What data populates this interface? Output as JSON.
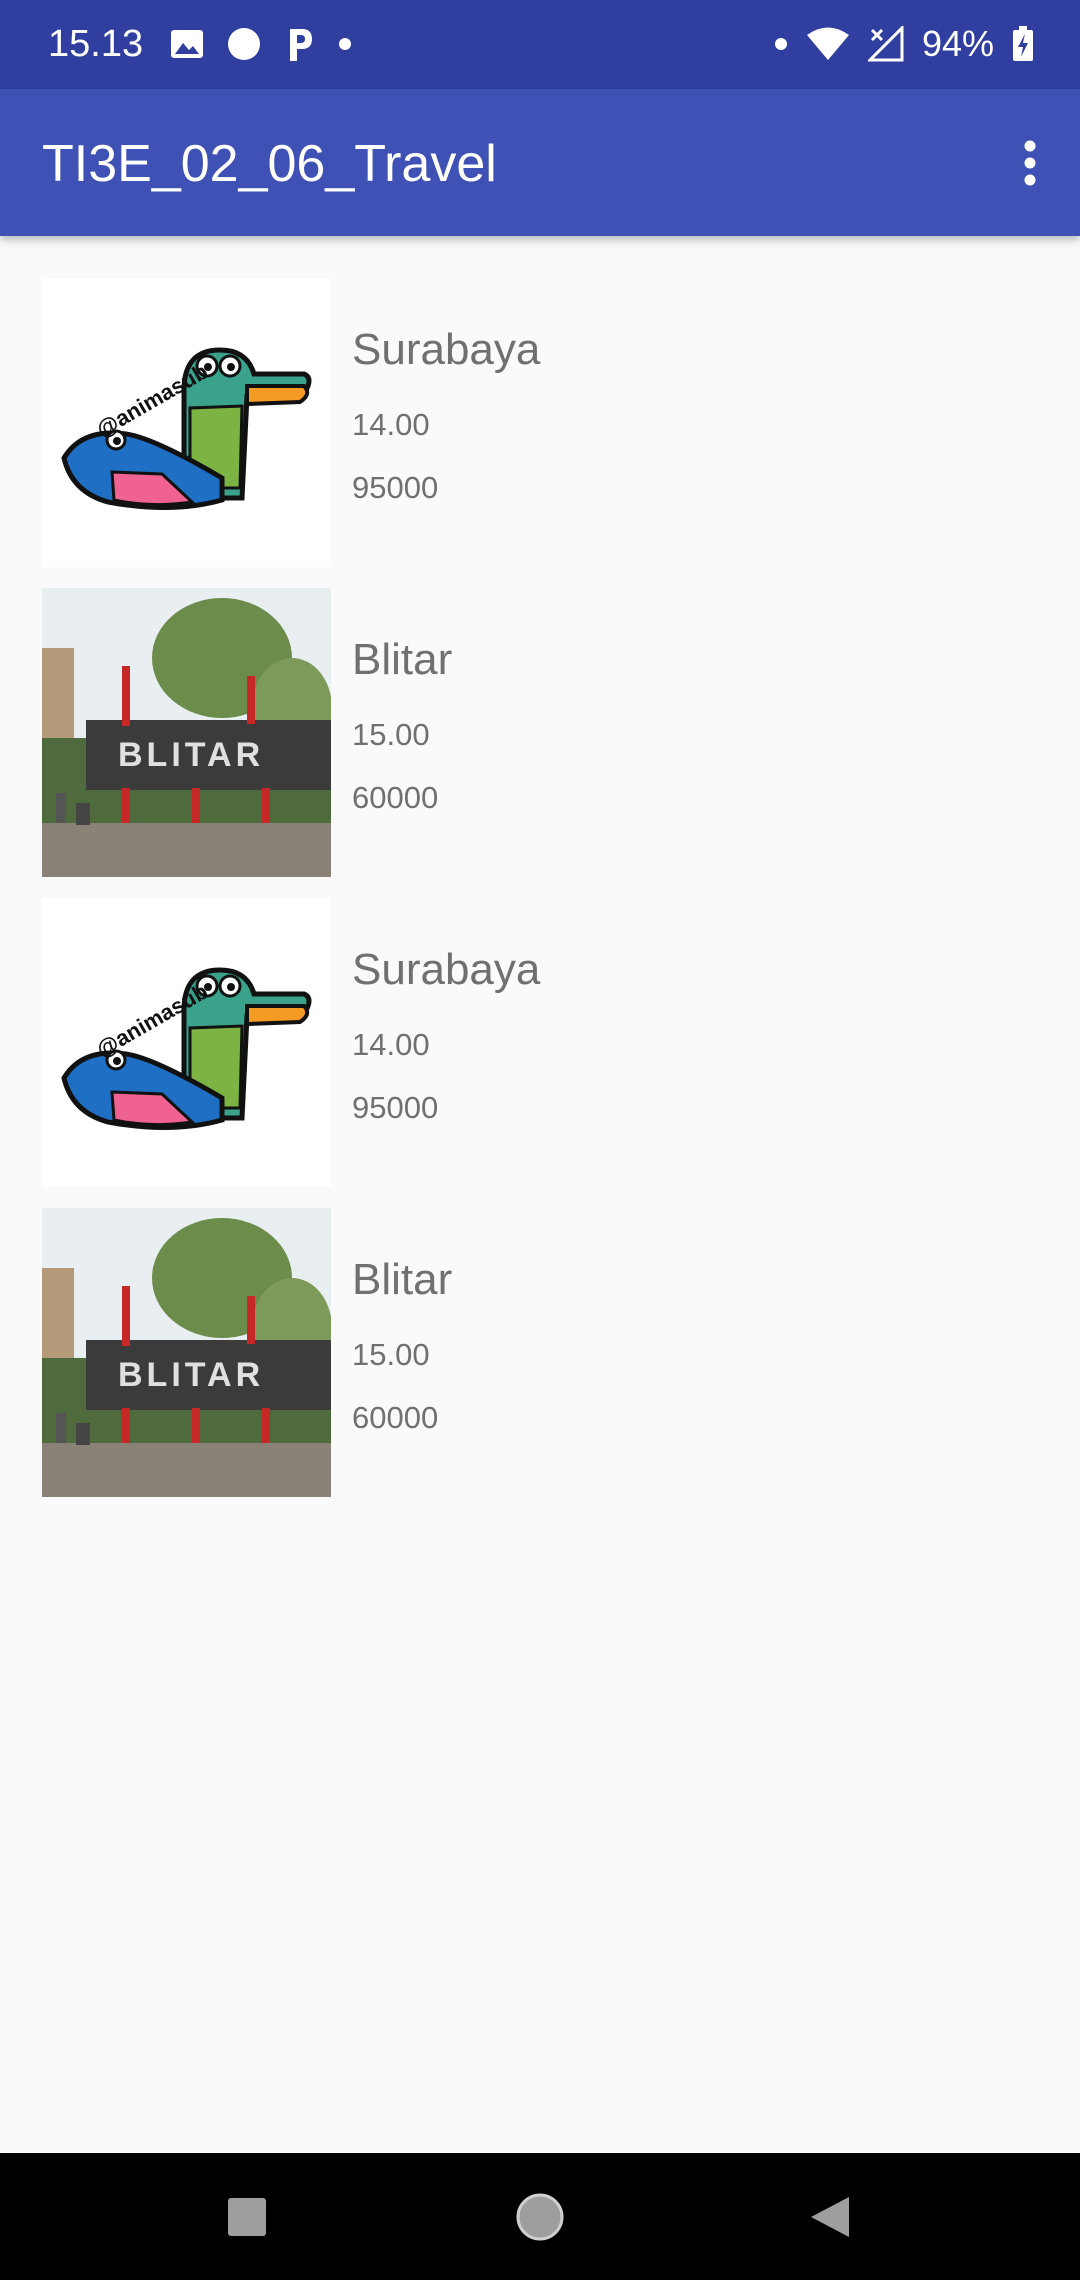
{
  "status_bar": {
    "time": "15.13",
    "battery": "94%",
    "icons": [
      "image-icon",
      "circle-icon",
      "parking-icon",
      "dot-icon",
      "wifi-icon",
      "signal-icon",
      "battery-charging-icon"
    ]
  },
  "app_bar": {
    "title": "TI3E_02_06_Travel",
    "overflow_icon": "more-vert-icon"
  },
  "items": [
    {
      "name": "Surabaya",
      "time": "14.00",
      "price": "95000",
      "image": "crocodile-logo"
    },
    {
      "name": "Blitar",
      "time": "15.00",
      "price": "60000",
      "image": "blitar-sign-photo"
    },
    {
      "name": "Surabaya",
      "time": "14.00",
      "price": "95000",
      "image": "crocodile-logo"
    },
    {
      "name": "Blitar",
      "time": "15.00",
      "price": "60000",
      "image": "blitar-sign-photo"
    }
  ],
  "blitar_sign_text": "BLITAR",
  "crocodile_logo_text": "@animasub",
  "nav_bar": {
    "icons": [
      "recents-square-icon",
      "home-circle-icon",
      "back-triangle-icon"
    ]
  },
  "colors": {
    "status_bar": "#303f9f",
    "app_bar": "#3f51b5",
    "background": "#fafafa",
    "text": "#707070"
  }
}
